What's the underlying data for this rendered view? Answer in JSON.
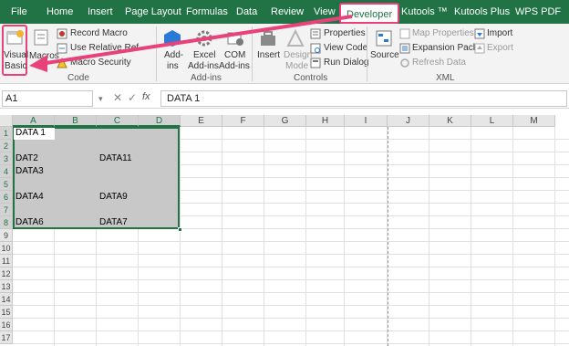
{
  "tabs": {
    "file": "File",
    "home": "Home",
    "insert": "Insert",
    "page_layout": "Page Layout",
    "formulas": "Formulas",
    "data": "Data",
    "review": "Review",
    "view": "View",
    "developer": "Developer",
    "kutools": "Kutools ™",
    "kutools_plus": "Kutools Plus",
    "wps_pdf": "WPS PDF"
  },
  "ribbon": {
    "code": {
      "visual_basic_line1": "Visual",
      "visual_basic_line2": "Basic",
      "macros": "Macros",
      "record_macro": "Record Macro",
      "use_relative": "Use Relative Ref",
      "macro_security": "Macro Security",
      "group_label": "Code"
    },
    "addins": {
      "addins_line1": "Add-",
      "addins_line2": "ins",
      "excel_addins_line1": "Excel",
      "excel_addins_line2": "Add-ins",
      "com_addins_line1": "COM",
      "com_addins_line2": "Add-ins",
      "group_label": "Add-ins"
    },
    "controls": {
      "insert": "Insert",
      "design_mode_line1": "Design",
      "design_mode_line2": "Mode",
      "properties": "Properties",
      "view_code": "View Code",
      "run_dialog": "Run Dialog",
      "group_label": "Controls"
    },
    "xml": {
      "source": "Source",
      "map_properties": "Map Properties",
      "expansion_packs": "Expansion Packs",
      "refresh_data": "Refresh Data",
      "import": "Import",
      "export": "Export",
      "group_label": "XML"
    }
  },
  "formula_bar": {
    "name_box": "A1",
    "fx": "fx",
    "formula": "DATA 1"
  },
  "columns": [
    "A",
    "B",
    "C",
    "D",
    "E",
    "F",
    "G",
    "H",
    "I",
    "J",
    "K",
    "L",
    "M"
  ],
  "rows": [
    "1",
    "2",
    "3",
    "4",
    "5",
    "6",
    "7",
    "8",
    "9",
    "10",
    "11",
    "12",
    "13",
    "14",
    "15",
    "16",
    "17"
  ],
  "cells": {
    "A1": "DATA 1",
    "A3": "DAT2",
    "C3": "DATA11",
    "A4": "DATA3",
    "A6": "DATA4",
    "C6": "DATA9",
    "A8": "DATA6",
    "C8": "DATA7"
  },
  "colors": {
    "excel_green": "#217346",
    "highlight": "#e9417a",
    "selection": "#c8c8c8"
  }
}
